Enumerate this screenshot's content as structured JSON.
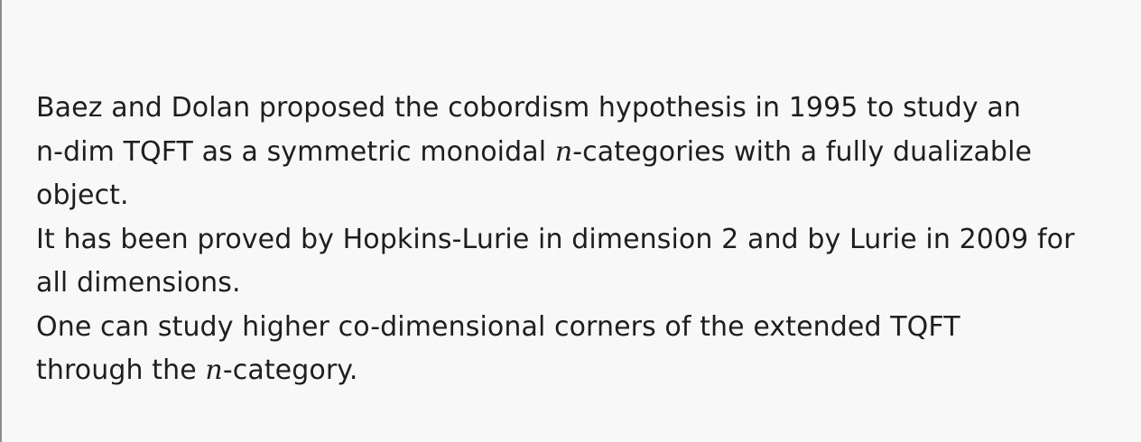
{
  "slide": {
    "lines": [
      {
        "pre": "Baez and Dolan proposed the cobordism hypothesis in 1995 to study an",
        "math": "",
        "post": ""
      },
      {
        "pre": "n-dim TQFT as a symmetric monoidal ",
        "math": "n",
        "post": "-categories with a fully dualizable"
      },
      {
        "pre": "object.",
        "math": "",
        "post": ""
      },
      {
        "pre": "It has been proved by Hopkins-Lurie in dimension 2 and by Lurie in 2009 for",
        "math": "",
        "post": ""
      },
      {
        "pre": "all dimensions.",
        "math": "",
        "post": ""
      },
      {
        "pre": "One can study higher co-dimensional corners of the extended TQFT",
        "math": "",
        "post": ""
      },
      {
        "pre": "through the ",
        "math": "n",
        "post": "-category."
      }
    ]
  }
}
